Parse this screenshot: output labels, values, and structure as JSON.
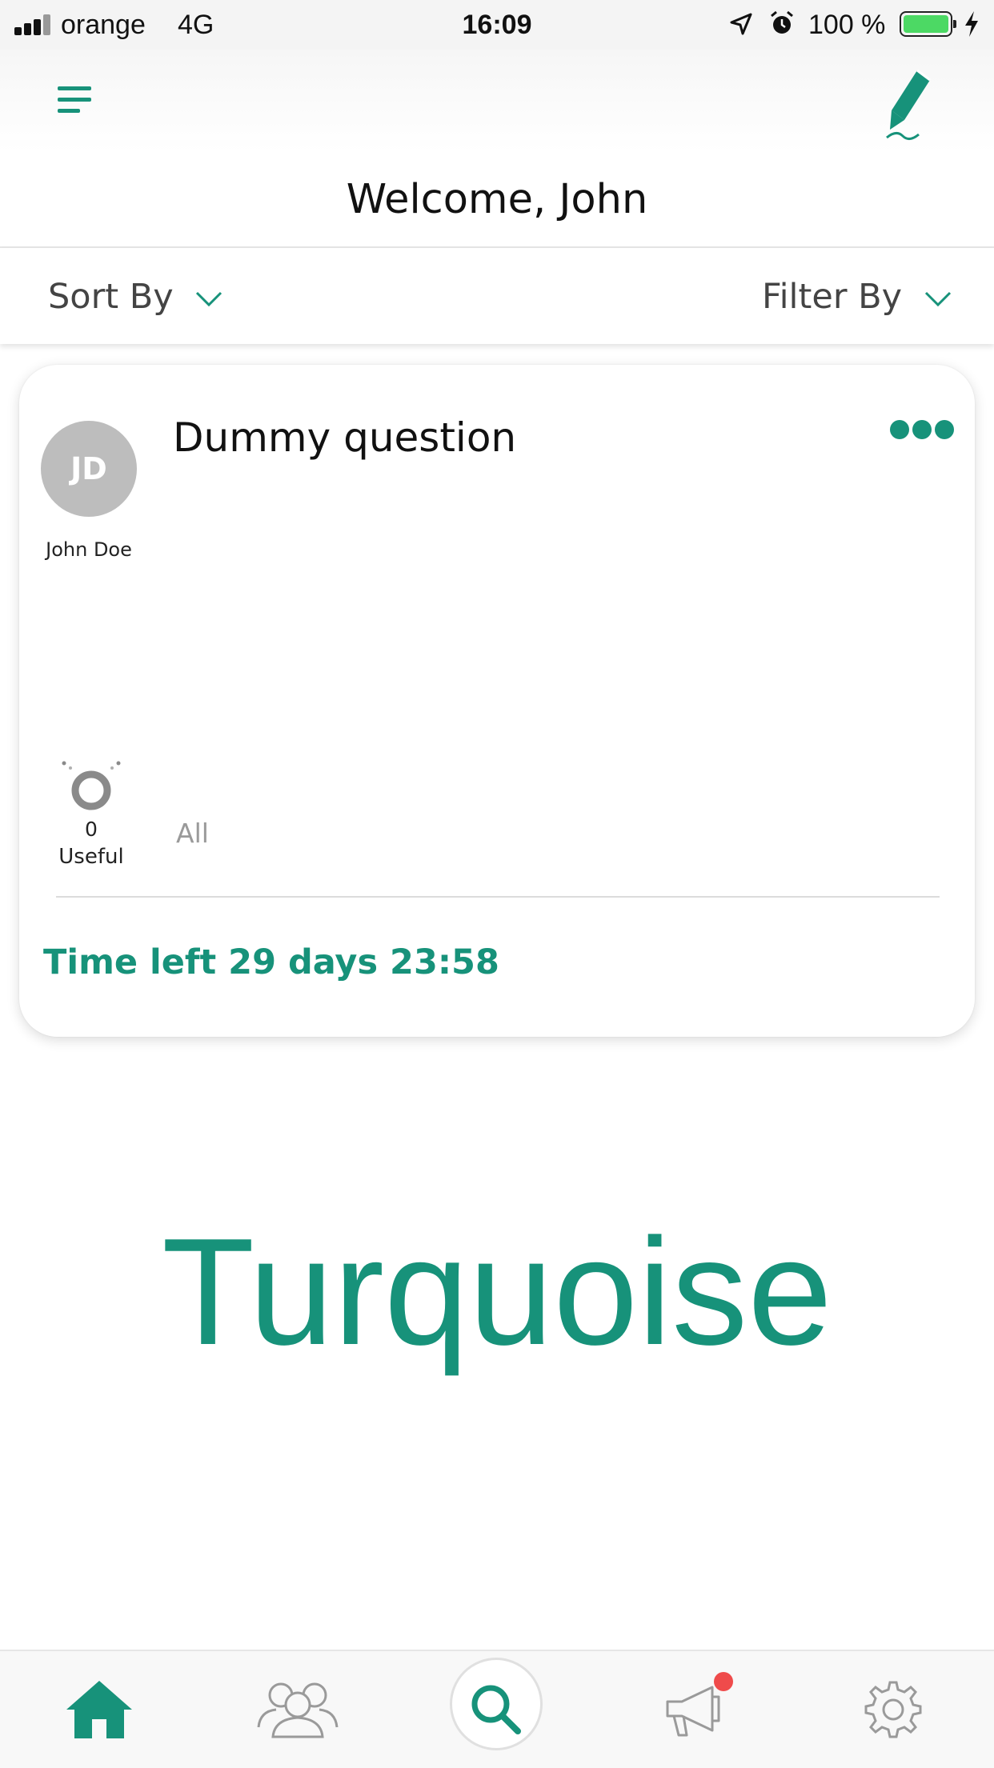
{
  "status_bar": {
    "carrier": "orange",
    "network": "4G",
    "time": "16:09",
    "battery": "100 %",
    "battery_color": "#4cd964",
    "icons": [
      "signal-icon",
      "location-icon",
      "alarm-icon",
      "battery-icon",
      "charging-icon"
    ]
  },
  "header": {
    "menu_icon": "hamburger-menu-icon",
    "edit_icon": "pencil-icon",
    "welcome": "Welcome, John"
  },
  "toolbar": {
    "sort_label": "Sort By",
    "filter_label": "Filter By"
  },
  "question": {
    "author_initials": "JD",
    "author_name": "John Doe",
    "title": "Dummy question",
    "useful_count": "0",
    "useful_label": "Useful",
    "all_label": "All",
    "time_left": "Time left 29 days 23:58"
  },
  "brand": {
    "name": "Turquoise"
  },
  "tabs": [
    {
      "name": "home",
      "icon": "home-icon",
      "active": true
    },
    {
      "name": "community",
      "icon": "people-icon",
      "active": false
    },
    {
      "name": "search",
      "icon": "search-icon",
      "active": false
    },
    {
      "name": "announcements",
      "icon": "megaphone-icon",
      "active": false,
      "badge": true
    },
    {
      "name": "settings",
      "icon": "gear-icon",
      "active": false
    }
  ],
  "colors": {
    "accent": "#17927a",
    "avatar_bg": "#bdbdbd",
    "badge": "#ef4b4b"
  }
}
